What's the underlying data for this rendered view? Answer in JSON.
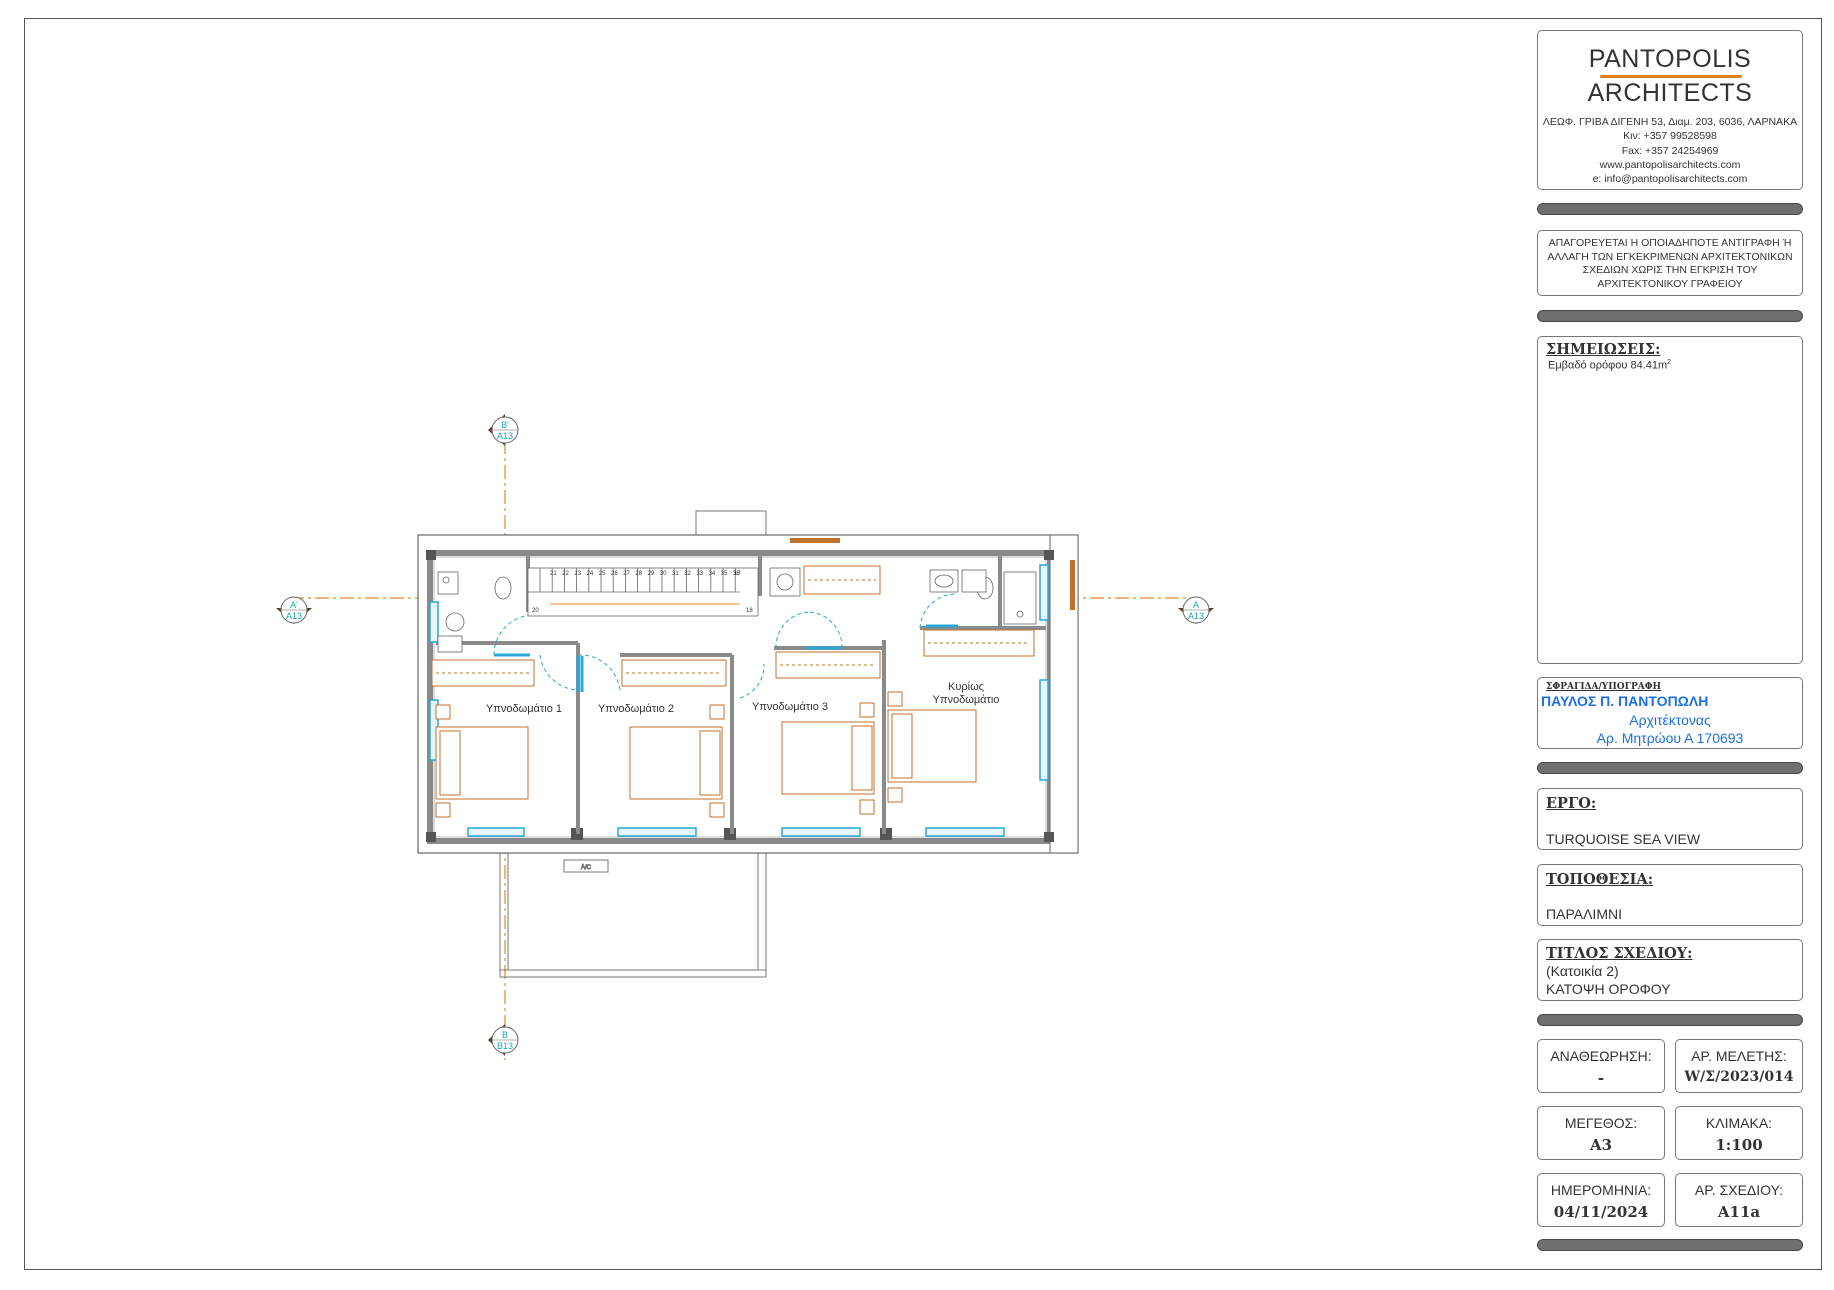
{
  "firm": {
    "name_line1": "PANTOPOLIS",
    "name_line2": "ARCHITECTS",
    "address": "ΛΕΩΦ. ΓΡΙΒΑ ΔΙΓΕΝΗ 53, Διαμ. 203, 6036, ΛΑΡΝΑΚΑ",
    "mobile": "Κιν: +357 99528598",
    "fax": "Fax: +357 24254969",
    "website": "www.pantopolisarchitects.com",
    "email": "e: info@pantopolisarchitects.com",
    "accent_color": "#e0801a"
  },
  "copyright_notice": "ΑΠΑΓΟΡΕΥΕΤΑΙ Η ΟΠΟΙΑΔΗΠΟΤΕ ΑΝΤΙΓΡΑΦΗ Ή ΑΛΛΑΓΗ ΤΩΝ ΕΓΚΕΚΡΙΜΕΝΩΝ ΑΡΧΙΤΕΚΤΟΝΙΚΩΝ ΣΧΕΔΙΩΝ ΧΩΡΙΣ ΤΗΝ ΕΓΚΡΙΣΗ ΤΟΥ ΑΡΧΙΤΕΚΤΟΝΙΚΟΥ ΓΡΑΦΕΙΟΥ",
  "notes": {
    "header": "ΣΗΜΕΙΩΣΕΙΣ:",
    "text": "Εμβαδό ορόφου 84.41m",
    "superscript": "2"
  },
  "stamp": {
    "header": "ΣΦΡΑΓΙΔΑ/ΥΠΟΓΡΑΦΗ",
    "name": "ΠΑΥΛΟΣ Π. ΠΑΝΤΟΠΩΛΗ",
    "title": "Αρχιτέκτονας",
    "registry": "Αρ. Μητρώου Α 170693",
    "color": "#1b6fe0"
  },
  "project": {
    "header": "ΕΡΓΟ:",
    "value": "TURQUOISE SEA VIEW"
  },
  "location": {
    "header": "ΤΟΠΟΘΕΣΙΑ:",
    "value": "ΠΑΡΑΛΙΜΝΙ"
  },
  "drawing_title": {
    "header": "ΤΙΤΛΟΣ ΣΧΕΔΙΟΥ:",
    "line1": "(Κατοικία 2)",
    "line2": "ΚΑΤΟΨΗ ΟΡΟΦΟΥ"
  },
  "info_cells": {
    "revision": {
      "label": "ΑΝΑΘΕΩΡΗΣΗ:",
      "value": "-"
    },
    "study_no": {
      "label": "ΑΡ. ΜΕΛΕΤΗΣ:",
      "value": "W/Σ/2023/014"
    },
    "size": {
      "label": "ΜΕΓΕΘΟΣ:",
      "value": "A3"
    },
    "scale": {
      "label": "ΚΛΙΜΑΚΑ:",
      "value": "1:100"
    },
    "date": {
      "label": "ΗΜΕΡΟΜΗΝΙΑ:",
      "value": "04/11/2024"
    },
    "drawing_no": {
      "label": "ΑΡ. ΣΧΕΔΙΟΥ:",
      "value": "A11a"
    }
  },
  "plan": {
    "rooms": {
      "bedroom1": "Υπνοδωμάτιο 1",
      "bedroom2": "Υπνοδωμάτιο 2",
      "bedroom3": "Υπνοδωμάτιο 3",
      "master_line1": "Κυρίως",
      "master_line2": "Υπνοδωμάτιο"
    },
    "ac_label": "A/C",
    "section_markers": {
      "top": {
        "letter": "B'",
        "ref": "A13"
      },
      "left": {
        "letter": "A'",
        "ref": "A13"
      },
      "right": {
        "letter": "A",
        "ref": "A13"
      },
      "bottom": {
        "letter": "B",
        "ref": "B13"
      }
    },
    "stair_numbers": [
      "21",
      "22",
      "23",
      "24",
      "25",
      "26",
      "27",
      "28",
      "29",
      "30",
      "31",
      "32",
      "33",
      "34",
      "35",
      "36",
      "17",
      "18",
      "20"
    ],
    "colors": {
      "furniture": "#c0722e",
      "section_line": "#e8862b",
      "glazing": "#2aa7d6",
      "wall": "#8a8a8a"
    }
  }
}
